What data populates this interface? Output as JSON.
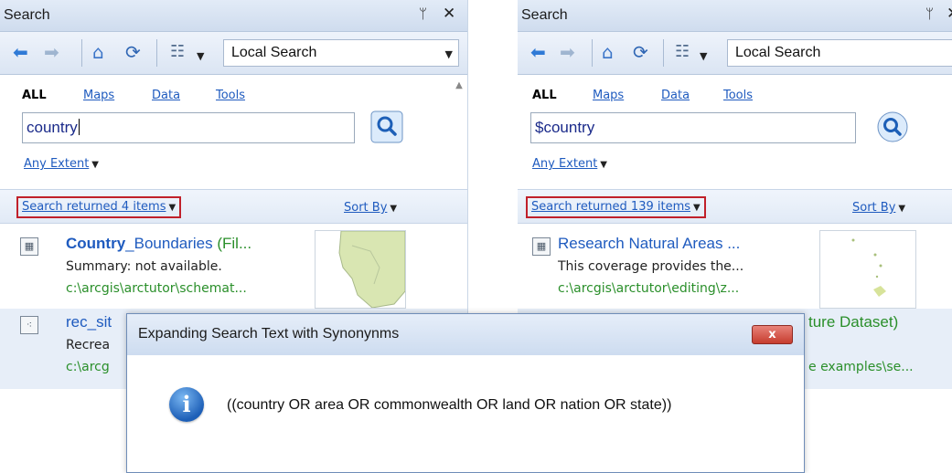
{
  "left": {
    "title": "Search",
    "scope": "Local Search",
    "filters": {
      "all": "ALL",
      "maps": "Maps",
      "data": "Data",
      "tools": "Tools"
    },
    "search_value": "country",
    "extent": "Any Extent",
    "count": "Search returned 4 items",
    "sort": "Sort By",
    "results": [
      {
        "title_bold": "Country",
        "title_rest": "_Boundaries",
        "type": " (Fil...",
        "summary": "Summary: not available.",
        "path": "c:\\arcgis\\arctutor\\schemat..."
      },
      {
        "title_bold": "",
        "title_rest": "rec_sit",
        "type": "",
        "summary": "Recrea",
        "path": "c:\\arcg"
      }
    ]
  },
  "right": {
    "title": "Search",
    "scope": "Local Search",
    "filters": {
      "all": "ALL",
      "maps": "Maps",
      "data": "Data",
      "tools": "Tools"
    },
    "search_value": "$country",
    "extent": "Any Extent",
    "count": "Search returned 139 items",
    "sort": "Sort By",
    "results": [
      {
        "title": "Research Natural Areas ...",
        "summary": "This coverage provides the...",
        "path": "c:\\arcgis\\arctutor\\editing\\z..."
      },
      {
        "type_tail": "ture Dataset)",
        "path_tail": "e examples\\se..."
      }
    ]
  },
  "dialog": {
    "title": "Expanding Search Text with Synonynms",
    "message": "((country OR area OR commonwealth OR land OR nation OR state))",
    "close": "x"
  },
  "colors": {
    "link": "#1f5bbf",
    "path": "#2a8f2a",
    "highlight_box": "#c0202a"
  },
  "icons": [
    "back-arrow-icon",
    "forward-arrow-icon",
    "home-icon",
    "refresh-icon",
    "view-list-icon",
    "search-go-icon",
    "info-icon",
    "pin-icon",
    "close-icon"
  ]
}
